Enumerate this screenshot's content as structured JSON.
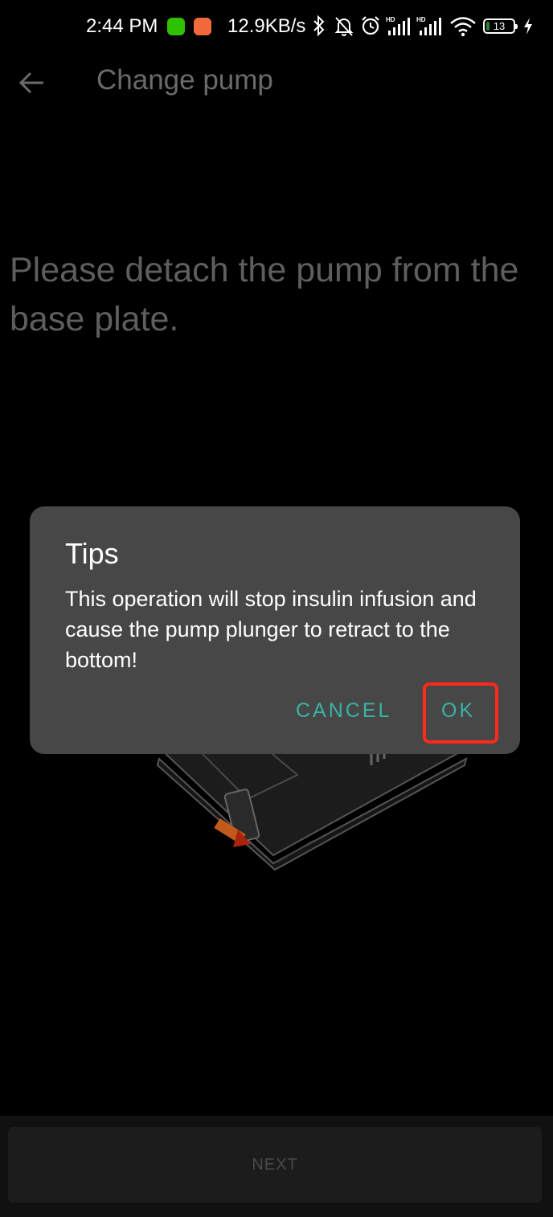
{
  "status_bar": {
    "time": "2:44 PM",
    "network_speed": "12.9KB/s",
    "battery_level": "13",
    "battery_percent": 13,
    "icons": [
      "wechat-icon",
      "app-store-icon",
      "bluetooth-icon",
      "mute-icon",
      "alarm-icon",
      "hd-signal-icon",
      "hd-signal-icon",
      "wifi-icon",
      "battery-icon",
      "charging-icon"
    ]
  },
  "header": {
    "title": "Change pump",
    "back_icon": "arrow-left-icon"
  },
  "main": {
    "instruction": "Please detach the pump from the base plate."
  },
  "dialog": {
    "title": "Tips",
    "message": "This operation will stop insulin infusion and cause the pump plunger to retract to the bottom!",
    "cancel_label": "CANCEL",
    "ok_label": "OK"
  },
  "footer": {
    "next_label": "NEXT"
  },
  "colors": {
    "accent": "#3ab3a4",
    "highlight": "#ff2a1a",
    "dialog_bg": "#474747",
    "background": "#000000"
  }
}
